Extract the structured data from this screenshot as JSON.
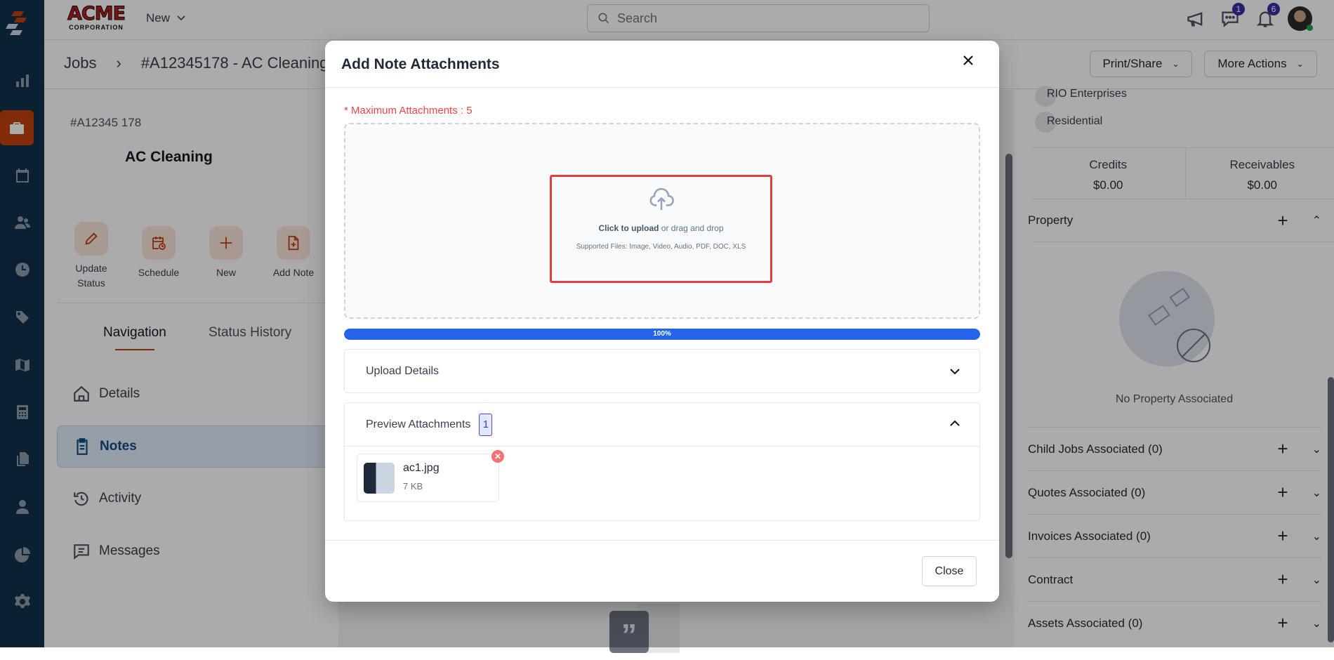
{
  "header": {
    "brand_top": "ACME",
    "brand_bottom": "CORPORATION",
    "new_label": "New",
    "search_placeholder": "Search",
    "chat_badge": "1",
    "notif_badge": "6"
  },
  "sidebar": {
    "items": [
      "logo",
      "dashboard",
      "jobs",
      "calendar",
      "customers",
      "timesheets",
      "pricebook",
      "map",
      "estimates",
      "documents",
      "users",
      "reports",
      "settings"
    ],
    "active": "jobs"
  },
  "breadcrumb": {
    "root": "Jobs",
    "current": "#A12345178 - AC Cleaning"
  },
  "actions": {
    "print_share": "Print/Share",
    "more_actions": "More Actions"
  },
  "job": {
    "number": "#A12345 178",
    "title": "AC Cleaning",
    "buttons": [
      {
        "label1": "Update",
        "label2": "Status"
      },
      {
        "label1": "Schedule"
      },
      {
        "label1": "New"
      },
      {
        "label1": "Add Note"
      }
    ],
    "tabs": [
      "Navigation",
      "Status History"
    ],
    "nav": [
      "Details",
      "Notes",
      "Activity",
      "Messages"
    ]
  },
  "right": {
    "company": "RIO Enterprises",
    "type": "Residential",
    "credits_label": "Credits",
    "credits_value": "$0.00",
    "receivables_label": "Receivables",
    "receivables_value": "$0.00",
    "property_label": "Property",
    "no_property": "No Property Associated",
    "sections": [
      "Child Jobs Associated (0)",
      "Quotes Associated (0)",
      "Invoices Associated (0)",
      "Contract",
      "Assets Associated (0)"
    ]
  },
  "modal": {
    "title": "Add Note Attachments",
    "max_note": "* Maximum Attachments : 5",
    "click_upload": "Click to upload",
    "drag_drop": " or drag and drop",
    "supported": "Supported Files: Image, Video, Audio, PDF, DOC, XLS",
    "progress_label": "100%",
    "progress_percent": 100,
    "upload_details": "Upload Details",
    "preview": "Preview Attachments",
    "preview_count": "1",
    "file": {
      "name": "ac1.jpg",
      "size": "7 KB"
    },
    "close_label": "Close"
  },
  "colors": {
    "accent": "#c2410c",
    "progress": "#2563eb",
    "danger": "#ef4444"
  }
}
